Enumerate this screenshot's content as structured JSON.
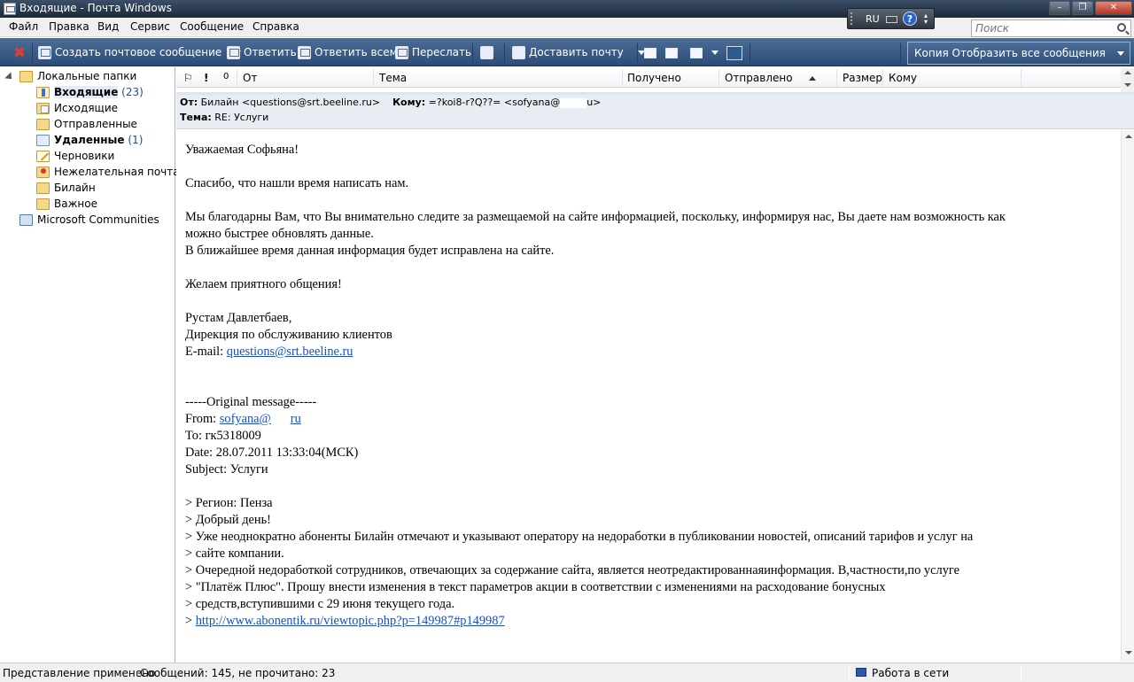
{
  "window": {
    "title": "Входящие - Почта Windows",
    "buttons": [
      "–",
      "❐",
      "✕"
    ]
  },
  "language_bar": {
    "lang": "RU",
    "help": "?"
  },
  "menubar": {
    "items": [
      "Файл",
      "Правка",
      "Вид",
      "Сервис",
      "Сообщение",
      "Справка"
    ]
  },
  "search": {
    "placeholder": "Поиск"
  },
  "toolbar": {
    "create": "Создать почтовое сообщение",
    "reply": "Ответить",
    "reply_all": "Ответить всем",
    "forward": "Переслать",
    "deliver": "Доставить почту",
    "view_select": "Копия Отобразить все сообщения"
  },
  "folders": {
    "root": "Локальные папки",
    "items": [
      {
        "label": "Входящие",
        "count": "(23)"
      },
      {
        "label": "Исходящие",
        "count": ""
      },
      {
        "label": "Отправленные",
        "count": ""
      },
      {
        "label": "Удаленные",
        "count": "(1)"
      },
      {
        "label": "Черновики",
        "count": ""
      },
      {
        "label": "Нежелательная почта",
        "count": ""
      },
      {
        "label": "Билайн",
        "count": ""
      },
      {
        "label": "Важное",
        "count": ""
      }
    ],
    "communities": "Microsoft Communities"
  },
  "list_columns": {
    "flag": "⚐",
    "priority": "!",
    "attachment": "0",
    "from": "От",
    "subject": "Тема",
    "received": "Получено",
    "sent": "Отправлено",
    "size": "Размер",
    "to": "Кому"
  },
  "preview": {
    "from_label": "От:",
    "from_value": "Билайн <questions@srt.beeline.ru>",
    "to_label": "Кому:",
    "to_value_start": "=?koi8-r?Q??= <sofyana@",
    "to_value_end": "u>",
    "subject_label": "Тема:",
    "subject_value": "RE: Услуги"
  },
  "message": {
    "greeting": "Уважаемая Софьяна!",
    "thanks": "Спасибо, что нашли время написать нам.",
    "para1_line1": "Мы благодарны Вам, что Вы внимательно следите за размещаемой на сайте информацией, поскольку, информируя нас, Вы даете нам возможность как",
    "para1_line2": "можно быстрее обновлять данные.",
    "para1_line3": "В ближайшее время данная информация будет исправлена на сайте.",
    "wish": "Желаем приятного общения!",
    "sig_name": "Рустам Давлетбаев,",
    "sig_dept": "Дирекция по обслуживанию клиентов",
    "sig_email_label": "E-mail: ",
    "sig_email": "questions@srt.beeline.ru",
    "orig_header": "-----Original message-----",
    "orig_from_label": "From: ",
    "orig_from_start": "sofyana@",
    "orig_from_end": "ru",
    "orig_to": "To: гк5318009",
    "orig_date": "Date: 28.07.2011 13:33:04(МСК)",
    "orig_subject": "Subject: Услуги",
    "quote_lines": [
      "> Регион: Пенза",
      "> Добрый день!",
      "> Уже неоднократно абоненты Билайн отмечают и указывают оператору на недоработки в публиковании новостей, описаний тарифов и услуг на",
      "> сайте компании.",
      "> Очередной недоработкой сотрудников, отвечающих за содержание сайта, является неотредактированнаяинформация. В,частности,по услуге",
      "> \"Платёж Плюс\". Прошу внести изменения в текст параметров акции в соответствии с изменениями на расходование бонусных",
      "> средств,вступившими с 29 июня текущего года."
    ],
    "quote_link_prefix": "> ",
    "quote_link": "http://www.abonentik.ru/viewtopic.php?p=149987#p149987"
  },
  "statusbar": {
    "view_applied": "Представление применено",
    "counts": "Сообщений: 145, не прочитано: 23",
    "online": "Работа в сети"
  }
}
